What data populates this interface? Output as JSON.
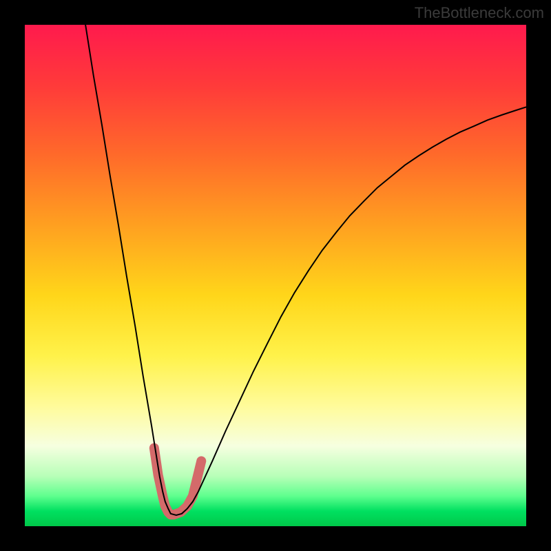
{
  "watermark": "TheBottleneck.com",
  "chart_data": {
    "type": "line",
    "title": "",
    "xlabel": "",
    "ylabel": "",
    "xlim": [
      0,
      100
    ],
    "ylim": [
      0,
      100
    ],
    "grid": false,
    "legend": false,
    "series": [
      {
        "name": "thin-curve",
        "color": "#000000",
        "width": 2,
        "x": [
          12.1,
          13.7,
          15.4,
          17.0,
          18.7,
          20.3,
          22.0,
          23.6,
          25.3,
          26.9,
          27.5,
          28.0,
          28.6,
          29.1,
          30.2,
          31.3,
          32.4,
          33.5,
          34.6,
          37.4,
          40.1,
          42.9,
          45.6,
          48.4,
          51.1,
          53.8,
          56.6,
          59.3,
          62.1,
          64.8,
          67.6,
          70.3,
          73.1,
          75.8,
          78.6,
          81.3,
          84.1,
          86.8,
          89.6,
          92.3,
          95.1,
          97.8,
          100.0
        ],
        "y": [
          100.0,
          89.9,
          79.9,
          69.9,
          59.9,
          49.9,
          39.9,
          29.9,
          19.9,
          9.9,
          6.9,
          4.9,
          3.5,
          2.5,
          2.2,
          2.5,
          3.5,
          4.9,
          6.9,
          13.0,
          19.1,
          25.1,
          30.9,
          36.5,
          41.8,
          46.6,
          51.0,
          55.0,
          58.6,
          61.9,
          64.8,
          67.5,
          69.8,
          72.0,
          73.9,
          75.6,
          77.2,
          78.6,
          79.8,
          81.0,
          82.0,
          82.9,
          83.6
        ]
      },
      {
        "name": "thick-curve",
        "color": "#d46a6a",
        "width": 14,
        "x": [
          25.8,
          26.6,
          27.5,
          28.0,
          28.6,
          29.1,
          29.7,
          31.1,
          32.4,
          33.5,
          35.2
        ],
        "y": [
          15.6,
          10.2,
          6.0,
          4.0,
          2.8,
          2.3,
          2.3,
          2.8,
          4.0,
          6.0,
          13.0
        ]
      }
    ]
  }
}
